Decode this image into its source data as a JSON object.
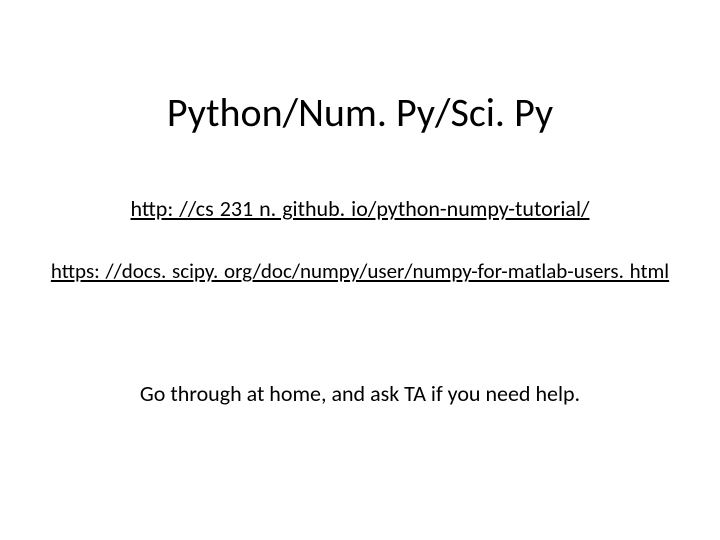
{
  "slide": {
    "title": "Python/Num. Py/Sci. Py",
    "link1_text": "http: //cs 231 n. github. io/python-numpy-tutorial/",
    "link2_text": "https: //docs. scipy. org/doc/numpy/user/numpy-for-matlab-users. html",
    "note": "Go through at home, and ask TA if you need help."
  }
}
